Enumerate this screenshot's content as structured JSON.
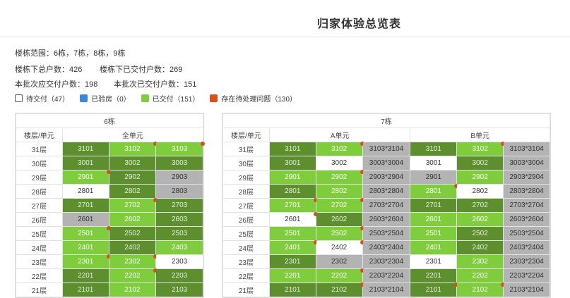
{
  "page": {
    "title": "归家体验总览表"
  },
  "info": {
    "range": "楼栋范围：6栋，7栋，8栋，9栋",
    "total_households": "楼栋下总户数：426",
    "delivered_households": "楼栋下已交付户数：269",
    "batch_should_deliver": "本批次应交付户数：198",
    "batch_delivered": "本批次已交付户数：151"
  },
  "legend": [
    {
      "label": "待交付（47）",
      "color": "#ffffff",
      "border": "#555555"
    },
    {
      "label": "已验房（0）",
      "color": "#3a86e0",
      "border": "#3a86e0"
    },
    {
      "label": "已交付（151）",
      "color": "#7fcc3c",
      "border": "#7fcc3c"
    },
    {
      "label": "存在待处理问题（130）",
      "color": "#e04b1e",
      "border": "#e04b1e"
    }
  ],
  "colors": {
    "dark_green": "#5d8f2e",
    "light_green": "#7fcc3c",
    "gray": "#b3b3b3",
    "white": "#ffffff",
    "issue_dot": "#e04b1e"
  },
  "building6": {
    "name": "6栋",
    "floor_header": "楼层/单元",
    "unit_header": "全单元",
    "rows": [
      {
        "floor": "31层",
        "cells": [
          {
            "t": "3101",
            "c": "dg",
            "d": false
          },
          {
            "t": "3102",
            "c": "lg2",
            "d": true
          },
          {
            "t": "3103",
            "c": "lg2",
            "d": true
          }
        ]
      },
      {
        "floor": "30层",
        "cells": [
          {
            "t": "3001",
            "c": "dg",
            "d": false
          },
          {
            "t": "3002",
            "c": "dg",
            "d": false
          },
          {
            "t": "3003",
            "c": "dg",
            "d": false
          }
        ]
      },
      {
        "floor": "29层",
        "cells": [
          {
            "t": "2901",
            "c": "lg2",
            "d": true
          },
          {
            "t": "2902",
            "c": "dg",
            "d": false
          },
          {
            "t": "2903",
            "c": "gr",
            "d": false
          }
        ]
      },
      {
        "floor": "28层",
        "cells": [
          {
            "t": "2801",
            "c": "wh",
            "d": false
          },
          {
            "t": "2802",
            "c": "dg",
            "d": false
          },
          {
            "t": "2803",
            "c": "gr",
            "d": false
          }
        ]
      },
      {
        "floor": "27层",
        "cells": [
          {
            "t": "2701",
            "c": "dg",
            "d": false
          },
          {
            "t": "2702",
            "c": "lg2",
            "d": true
          },
          {
            "t": "2703",
            "c": "dg",
            "d": false
          }
        ]
      },
      {
        "floor": "26层",
        "cells": [
          {
            "t": "2601",
            "c": "gr",
            "d": false
          },
          {
            "t": "2602",
            "c": "lg2",
            "d": false
          },
          {
            "t": "2603",
            "c": "dg",
            "d": false
          }
        ]
      },
      {
        "floor": "25层",
        "cells": [
          {
            "t": "2501",
            "c": "lg2",
            "d": true
          },
          {
            "t": "2502",
            "c": "dg",
            "d": false
          },
          {
            "t": "2503",
            "c": "dg",
            "d": false
          }
        ]
      },
      {
        "floor": "24层",
        "cells": [
          {
            "t": "2401",
            "c": "lg2",
            "d": false
          },
          {
            "t": "2402",
            "c": "dg",
            "d": false
          },
          {
            "t": "2403",
            "c": "lg2",
            "d": false
          }
        ]
      },
      {
        "floor": "23层",
        "cells": [
          {
            "t": "2301",
            "c": "lg2",
            "d": true
          },
          {
            "t": "2302",
            "c": "lg2",
            "d": true
          },
          {
            "t": "2303",
            "c": "wh",
            "d": false
          }
        ]
      },
      {
        "floor": "22层",
        "cells": [
          {
            "t": "2201",
            "c": "dg",
            "d": false
          },
          {
            "t": "2202",
            "c": "lg2",
            "d": true
          },
          {
            "t": "2203",
            "c": "dg",
            "d": false
          }
        ]
      },
      {
        "floor": "21层",
        "cells": [
          {
            "t": "2101",
            "c": "dg",
            "d": false
          },
          {
            "t": "2102",
            "c": "lg2",
            "d": false
          },
          {
            "t": "2103",
            "c": "dg",
            "d": false
          }
        ]
      }
    ]
  },
  "building7": {
    "name": "7栋",
    "floor_header": "楼层/单元",
    "unit_a": "A单元",
    "unit_b": "B单元",
    "rows": [
      {
        "floor": "31层",
        "cells": [
          {
            "t": "3101",
            "c": "dg",
            "d": false
          },
          {
            "t": "3102",
            "c": "lg2",
            "d": true
          },
          {
            "t": "3103*3104",
            "c": "gr",
            "d": false
          },
          {
            "t": "3101",
            "c": "dg",
            "d": false
          },
          {
            "t": "3102",
            "c": "lg2",
            "d": true
          },
          {
            "t": "3103*3104",
            "c": "gr",
            "d": false
          }
        ]
      },
      {
        "floor": "30层",
        "cells": [
          {
            "t": "3001",
            "c": "dg",
            "d": false
          },
          {
            "t": "3002",
            "c": "wh",
            "d": false
          },
          {
            "t": "3003*3004",
            "c": "gr",
            "d": false
          },
          {
            "t": "3001",
            "c": "wh",
            "d": false
          },
          {
            "t": "3002",
            "c": "dg",
            "d": false
          },
          {
            "t": "3003*3004",
            "c": "gr",
            "d": false
          }
        ]
      },
      {
        "floor": "29层",
        "cells": [
          {
            "t": "2901",
            "c": "lg2",
            "d": false
          },
          {
            "t": "2902",
            "c": "lg2",
            "d": true
          },
          {
            "t": "2903*2904",
            "c": "gr",
            "d": false
          },
          {
            "t": "2901",
            "c": "gr",
            "d": false
          },
          {
            "t": "2902",
            "c": "lg2",
            "d": false
          },
          {
            "t": "2903*2904",
            "c": "gr",
            "d": false
          }
        ]
      },
      {
        "floor": "28层",
        "cells": [
          {
            "t": "2801",
            "c": "dg",
            "d": false
          },
          {
            "t": "2802",
            "c": "lg2",
            "d": false
          },
          {
            "t": "2803*2804",
            "c": "gr",
            "d": false
          },
          {
            "t": "2801",
            "c": "lg2",
            "d": true
          },
          {
            "t": "2802",
            "c": "wh",
            "d": false
          },
          {
            "t": "2803*2804",
            "c": "gr",
            "d": false
          }
        ]
      },
      {
        "floor": "27层",
        "cells": [
          {
            "t": "2701",
            "c": "lg2",
            "d": true
          },
          {
            "t": "2702",
            "c": "lg2",
            "d": true
          },
          {
            "t": "2703*2704",
            "c": "gr",
            "d": false
          },
          {
            "t": "2701",
            "c": "dg",
            "d": false
          },
          {
            "t": "2702",
            "c": "dg",
            "d": false
          },
          {
            "t": "2703*2704",
            "c": "gr",
            "d": false
          }
        ]
      },
      {
        "floor": "26层",
        "cells": [
          {
            "t": "2601",
            "c": "wh",
            "d": true
          },
          {
            "t": "2602",
            "c": "dg",
            "d": false
          },
          {
            "t": "2603*2604",
            "c": "gr",
            "d": false
          },
          {
            "t": "2601",
            "c": "lg2",
            "d": false
          },
          {
            "t": "2602",
            "c": "lg2",
            "d": false
          },
          {
            "t": "2603*2604",
            "c": "gr",
            "d": false
          }
        ]
      },
      {
        "floor": "25层",
        "cells": [
          {
            "t": "2501",
            "c": "lg2",
            "d": false
          },
          {
            "t": "2502",
            "c": "lg2",
            "d": true
          },
          {
            "t": "2503*2504",
            "c": "gr",
            "d": false
          },
          {
            "t": "2501",
            "c": "lg2",
            "d": false
          },
          {
            "t": "2502",
            "c": "dg",
            "d": false
          },
          {
            "t": "2503*2504",
            "c": "gr",
            "d": false
          }
        ]
      },
      {
        "floor": "24层",
        "cells": [
          {
            "t": "2401",
            "c": "lg2",
            "d": true
          },
          {
            "t": "2402",
            "c": "wh",
            "d": true
          },
          {
            "t": "2403*2404",
            "c": "gr",
            "d": false
          },
          {
            "t": "2401",
            "c": "lg2",
            "d": false
          },
          {
            "t": "2402",
            "c": "dg",
            "d": false
          },
          {
            "t": "2403*2404",
            "c": "gr",
            "d": false
          }
        ]
      },
      {
        "floor": "23层",
        "cells": [
          {
            "t": "2301",
            "c": "dg",
            "d": false
          },
          {
            "t": "2302",
            "c": "gr",
            "d": false
          },
          {
            "t": "2303*2304",
            "c": "gr",
            "d": false
          },
          {
            "t": "2301",
            "c": "wh",
            "d": false
          },
          {
            "t": "2302",
            "c": "lg2",
            "d": false
          },
          {
            "t": "2303*2304",
            "c": "gr",
            "d": false
          }
        ]
      },
      {
        "floor": "22层",
        "cells": [
          {
            "t": "2201",
            "c": "lg2",
            "d": false
          },
          {
            "t": "2202",
            "c": "lg2",
            "d": true
          },
          {
            "t": "2203*2204",
            "c": "gr",
            "d": false
          },
          {
            "t": "2201",
            "c": "dg",
            "d": false
          },
          {
            "t": "2202",
            "c": "lg2",
            "d": false
          },
          {
            "t": "2203*2204",
            "c": "gr",
            "d": false
          }
        ]
      },
      {
        "floor": "21层",
        "cells": [
          {
            "t": "2101",
            "c": "dg",
            "d": false
          },
          {
            "t": "2102",
            "c": "dg",
            "d": true
          },
          {
            "t": "2103*2104",
            "c": "gr",
            "d": false
          },
          {
            "t": "2101",
            "c": "dg",
            "d": true
          },
          {
            "t": "2102",
            "c": "lg2",
            "d": true
          },
          {
            "t": "2103*2104",
            "c": "gr",
            "d": false
          }
        ]
      }
    ]
  }
}
